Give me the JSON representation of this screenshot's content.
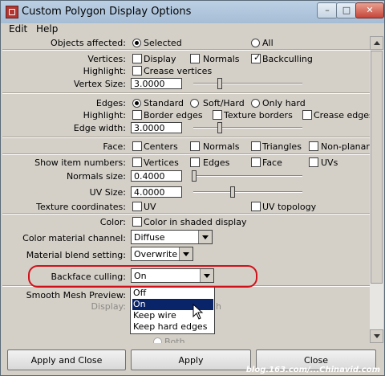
{
  "window": {
    "title": "Custom Polygon Display Options"
  },
  "menubar": {
    "items": [
      "Edit",
      "Help"
    ]
  },
  "objects_affected": {
    "label": "Objects affected:",
    "options": [
      "Selected",
      "All"
    ],
    "selected": "Selected"
  },
  "vertices": {
    "label": "Vertices:",
    "options": [
      {
        "label": "Display",
        "checked": false
      },
      {
        "label": "Normals",
        "checked": false
      },
      {
        "label": "Backculling",
        "checked": true
      }
    ]
  },
  "vertices_highlight": {
    "label": "Highlight:",
    "options": [
      {
        "label": "Crease vertices",
        "checked": false
      }
    ]
  },
  "vertex_size": {
    "label": "Vertex Size:",
    "value": "3.0000"
  },
  "edges": {
    "label": "Edges:",
    "options": [
      "Standard",
      "Soft/Hard",
      "Only hard"
    ],
    "selected": "Standard"
  },
  "edges_highlight": {
    "label": "Highlight:",
    "options": [
      {
        "label": "Border edges",
        "checked": false
      },
      {
        "label": "Texture borders",
        "checked": false
      },
      {
        "label": "Crease edges",
        "checked": false
      }
    ]
  },
  "edge_width": {
    "label": "Edge width:",
    "value": "3.0000"
  },
  "face": {
    "label": "Face:",
    "options": [
      {
        "label": "Centers",
        "checked": false
      },
      {
        "label": "Normals",
        "checked": false
      },
      {
        "label": "Triangles",
        "checked": false
      },
      {
        "label": "Non-planar",
        "checked": false
      }
    ]
  },
  "show_item_numbers": {
    "label": "Show item numbers:",
    "options": [
      {
        "label": "Vertices",
        "checked": false
      },
      {
        "label": "Edges",
        "checked": false
      },
      {
        "label": "Face",
        "checked": false
      },
      {
        "label": "UVs",
        "checked": false
      }
    ]
  },
  "normals_size": {
    "label": "Normals size:",
    "value": "0.4000"
  },
  "uv_size": {
    "label": "UV Size:",
    "value": "4.0000"
  },
  "texture_coordinates": {
    "label": "Texture coordinates:",
    "options": [
      {
        "label": "UV",
        "checked": false
      },
      {
        "label": "UV topology",
        "checked": false
      }
    ]
  },
  "color": {
    "label": "Color:",
    "option": {
      "label": "Color in shaded display",
      "checked": false
    }
  },
  "color_material_channel": {
    "label": "Color material channel:",
    "value": "Diffuse"
  },
  "material_blend_setting": {
    "label": "Material blend setting:",
    "value": "Overwrite"
  },
  "backface_culling": {
    "label": "Backface culling:",
    "value": "On",
    "options": [
      "Off",
      "On",
      "Keep wire",
      "Keep hard edges"
    ],
    "highlighted": "On"
  },
  "smooth_mesh_preview": {
    "label": "Smooth Mesh Preview:",
    "display_label": "Display:",
    "display_trailing": "h",
    "both_label": "Both"
  },
  "buttons": {
    "apply_close": "Apply and Close",
    "apply": "Apply",
    "close": "Close"
  },
  "watermark": {
    "text": "blog.163.com/...Chinavid.com"
  },
  "colors": {
    "highlight_ring": "#d0111a",
    "selection": "#0a246a",
    "dialog_bg": "#d4d0c8"
  }
}
